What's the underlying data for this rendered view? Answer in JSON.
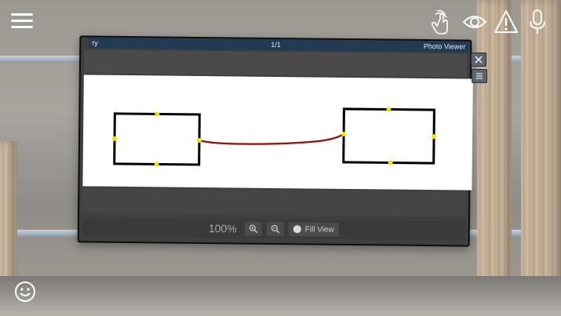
{
  "window": {
    "title_left": "ry",
    "page_indicator": "1/1",
    "app_title": "Photo Viewer"
  },
  "toolbar": {
    "zoom_level": "100%",
    "zoom_in_icon": "zoom-in-icon",
    "zoom_out_icon": "zoom-out-icon",
    "fill_view_label": "Fill View"
  },
  "top_icons": [
    "touch-hand-icon",
    "eye-icon",
    "warning-icon",
    "microphone-icon"
  ],
  "side_controls": [
    "close-icon",
    "list-menu-icon"
  ],
  "colors": {
    "title_bar": "#233a55",
    "connector_line": "#8a1a1a",
    "anchor_dot": "#f5e400",
    "panel_background": "#3f3f3f"
  },
  "diagram": {
    "node_count": 2,
    "connector_count": 1
  }
}
